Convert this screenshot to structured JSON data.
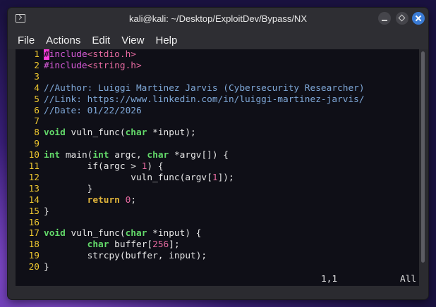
{
  "window": {
    "title": "kali@kali: ~/Desktop/ExploitDev/Bypass/NX"
  },
  "menu": [
    "File",
    "Actions",
    "Edit",
    "View",
    "Help"
  ],
  "editor": {
    "lines": [
      {
        "n": "1",
        "segs": [
          {
            "c": "cursor",
            "t": "#"
          },
          {
            "c": "pp",
            "t": "include"
          },
          {
            "c": "inc",
            "t": "<stdio.h>"
          }
        ]
      },
      {
        "n": "2",
        "segs": [
          {
            "c": "pp",
            "t": "#include"
          },
          {
            "c": "inc",
            "t": "<string.h>"
          }
        ]
      },
      {
        "n": "3",
        "segs": []
      },
      {
        "n": "4",
        "segs": [
          {
            "c": "cm",
            "t": "//Author: Luiggi Martinez Jarvis (Cybersecurity Researcher)"
          }
        ]
      },
      {
        "n": "5",
        "segs": [
          {
            "c": "cm",
            "t": "//Link: https://www.linkedin.com/in/luiggi-martinez-jarvis/"
          }
        ]
      },
      {
        "n": "6",
        "segs": [
          {
            "c": "cm",
            "t": "//Date: 01/22/2026"
          }
        ]
      },
      {
        "n": "7",
        "segs": []
      },
      {
        "n": "8",
        "segs": [
          {
            "c": "kw",
            "t": "void"
          },
          {
            "c": "",
            "t": " vuln_func("
          },
          {
            "c": "kw",
            "t": "char"
          },
          {
            "c": "",
            "t": " *input);"
          }
        ]
      },
      {
        "n": "9",
        "segs": []
      },
      {
        "n": "10",
        "segs": [
          {
            "c": "kw",
            "t": "int"
          },
          {
            "c": "",
            "t": " main("
          },
          {
            "c": "kw",
            "t": "int"
          },
          {
            "c": "",
            "t": " argc, "
          },
          {
            "c": "kw",
            "t": "char"
          },
          {
            "c": "",
            "t": " *argv[]) {"
          }
        ]
      },
      {
        "n": "11",
        "segs": [
          {
            "c": "",
            "t": "        if(argc > "
          },
          {
            "c": "num",
            "t": "1"
          },
          {
            "c": "",
            "t": ") {"
          }
        ]
      },
      {
        "n": "12",
        "segs": [
          {
            "c": "",
            "t": "                vuln_func(argv["
          },
          {
            "c": "num",
            "t": "1"
          },
          {
            "c": "",
            "t": "]);"
          }
        ]
      },
      {
        "n": "13",
        "segs": [
          {
            "c": "",
            "t": "        }"
          }
        ]
      },
      {
        "n": "14",
        "segs": [
          {
            "c": "",
            "t": "        "
          },
          {
            "c": "ctl",
            "t": "return"
          },
          {
            "c": "",
            "t": " "
          },
          {
            "c": "num",
            "t": "0"
          },
          {
            "c": "",
            "t": ";"
          }
        ]
      },
      {
        "n": "15",
        "segs": [
          {
            "c": "",
            "t": "}"
          }
        ]
      },
      {
        "n": "16",
        "segs": []
      },
      {
        "n": "17",
        "segs": [
          {
            "c": "kw",
            "t": "void"
          },
          {
            "c": "",
            "t": " vuln_func("
          },
          {
            "c": "kw",
            "t": "char"
          },
          {
            "c": "",
            "t": " *input) {"
          }
        ]
      },
      {
        "n": "18",
        "segs": [
          {
            "c": "",
            "t": "        "
          },
          {
            "c": "kw",
            "t": "char"
          },
          {
            "c": "",
            "t": " buffer["
          },
          {
            "c": "num",
            "t": "256"
          },
          {
            "c": "",
            "t": "];"
          }
        ]
      },
      {
        "n": "19",
        "segs": [
          {
            "c": "",
            "t": "        strcpy(buffer, input);"
          }
        ]
      },
      {
        "n": "20",
        "segs": [
          {
            "c": "",
            "t": "}"
          }
        ]
      }
    ],
    "status_position": "1,1",
    "status_scroll": "All"
  },
  "colors": {
    "terminal_bg": "#0f0f17",
    "line_number": "#f0c930",
    "type_keyword": "#63d96a",
    "control_keyword": "#e0b43a",
    "comment": "#7fa8d8",
    "preprocessor": "#d65ad8",
    "constant": "#e56aa0",
    "cursor": "#ff3dde",
    "close_button": "#3a7bd5"
  },
  "icons": [
    "terminal-icon",
    "minimize-icon",
    "maximize-icon",
    "close-icon"
  ]
}
